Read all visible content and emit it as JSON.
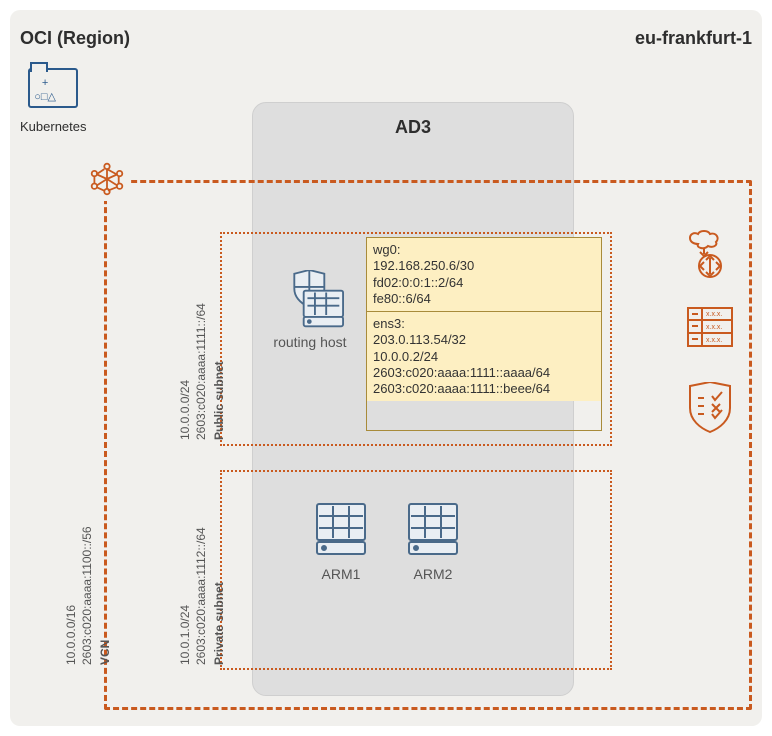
{
  "header": {
    "left": "OCI (Region)",
    "right": "eu-frankfurt-1"
  },
  "kubernetes": {
    "label": "Kubernetes"
  },
  "ad": {
    "title": "AD3"
  },
  "vcn": {
    "label": "VCN",
    "cidr_v4": "10.0.0.0/16",
    "cidr_v6": "2603:c020:aaaa:1100::/56"
  },
  "public_subnet": {
    "label": "Public subnet",
    "cidr_v4": "10.0.0.0/24",
    "cidr_v6": "2603:c020:aaaa:1111::/64"
  },
  "private_subnet": {
    "label": "Private subnet",
    "cidr_v4": "10.0.1.0/24",
    "cidr_v6": "2603:c020:aaaa:1112::/64"
  },
  "routing_host": {
    "label": "routing host",
    "interfaces": {
      "wg0": {
        "title": "wg0:",
        "lines": [
          "192.168.250.6/30",
          "fd02:0:0:1::2/64",
          "fe80::6/64"
        ]
      },
      "ens3": {
        "title": "ens3:",
        "lines": [
          "203.0.113.54/32",
          "10.0.0.2/24",
          "2603:c020:aaaa:1111::aaaa/64",
          "2603:c020:aaaa:1111::beee/64"
        ]
      }
    }
  },
  "arm_hosts": [
    "ARM1",
    "ARM2"
  ],
  "side_icons": [
    "internet-gateway-icon",
    "route-table-icon",
    "security-list-icon"
  ]
}
